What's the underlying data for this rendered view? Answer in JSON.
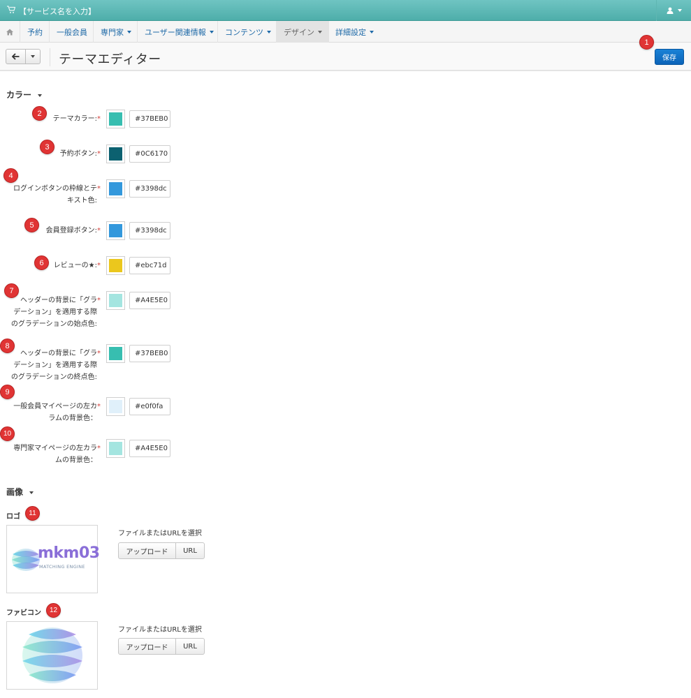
{
  "topbar": {
    "service_name": "【サービス名を入力】"
  },
  "nav": {
    "items": [
      {
        "label": "予約",
        "dropdown": false,
        "active": false
      },
      {
        "label": "一般会員",
        "dropdown": false,
        "active": false
      },
      {
        "label": "専門家",
        "dropdown": true,
        "active": false
      },
      {
        "label": "ユーザー関連情報",
        "dropdown": true,
        "active": false
      },
      {
        "label": "コンテンツ",
        "dropdown": true,
        "active": false
      },
      {
        "label": "デザイン",
        "dropdown": true,
        "active": true
      },
      {
        "label": "詳細設定",
        "dropdown": true,
        "active": false
      }
    ]
  },
  "header": {
    "title": "テーマエディター",
    "save_label": "保存"
  },
  "colors": {
    "section_title": "カラー",
    "required_mark": "*",
    "fields": [
      {
        "label": [
          "テーマカラー:"
        ],
        "value": "#37BEB0",
        "swatch": "#37beb0"
      },
      {
        "label": [
          "予約ボタン:"
        ],
        "value": "#0C6170",
        "swatch": "#0c6170"
      },
      {
        "label": [
          "ログインボタンの枠線とテ",
          "キスト色:"
        ],
        "value": "#3398dc",
        "swatch": "#3398dc"
      },
      {
        "label": [
          "会員登録ボタン:"
        ],
        "value": "#3398dc",
        "swatch": "#3398dc"
      },
      {
        "label": [
          "レビューの★:"
        ],
        "value": "#ebc71d",
        "swatch": "#ebc71d"
      },
      {
        "label": [
          "ヘッダーの背景に「グラ",
          "デーション」を適用する際",
          "のグラデーションの始点色:"
        ],
        "value": "#A4E5E0",
        "swatch": "#a4e5e0"
      },
      {
        "label": [
          "ヘッダーの背景に「グラ",
          "デーション」を適用する際",
          "のグラデーションの終点色:"
        ],
        "value": "#37BEB0",
        "swatch": "#37beb0"
      },
      {
        "label": [
          "一般会員マイページの左カ",
          "ラムの背景色："
        ],
        "value": "#e0f0fa",
        "swatch": "#e0f0fa"
      },
      {
        "label": [
          "専門家マイページの左カラ",
          "ムの背景色："
        ],
        "value": "#A4E5E0",
        "swatch": "#a4e5e0"
      }
    ]
  },
  "images": {
    "section_title": "画像",
    "logo": {
      "label": "ロゴ",
      "brand_text": "mkm03",
      "brand_sub": "MATCHING ENGINE",
      "caption": "ファイルまたはURLを選択",
      "upload_label": "アップロード",
      "url_label": "URL"
    },
    "favicon": {
      "label": "ファビコン",
      "caption": "ファイルまたはURLを選択",
      "upload_label": "アップロード",
      "url_label": "URL"
    }
  },
  "badges": [
    "1",
    "2",
    "3",
    "4",
    "5",
    "6",
    "7",
    "8",
    "9",
    "10",
    "11",
    "12"
  ],
  "theme": {
    "topbar": "#5ab8b5",
    "link": "#1f6aa8",
    "primary_button": "#0b6ec4",
    "badge": "#e03434"
  }
}
